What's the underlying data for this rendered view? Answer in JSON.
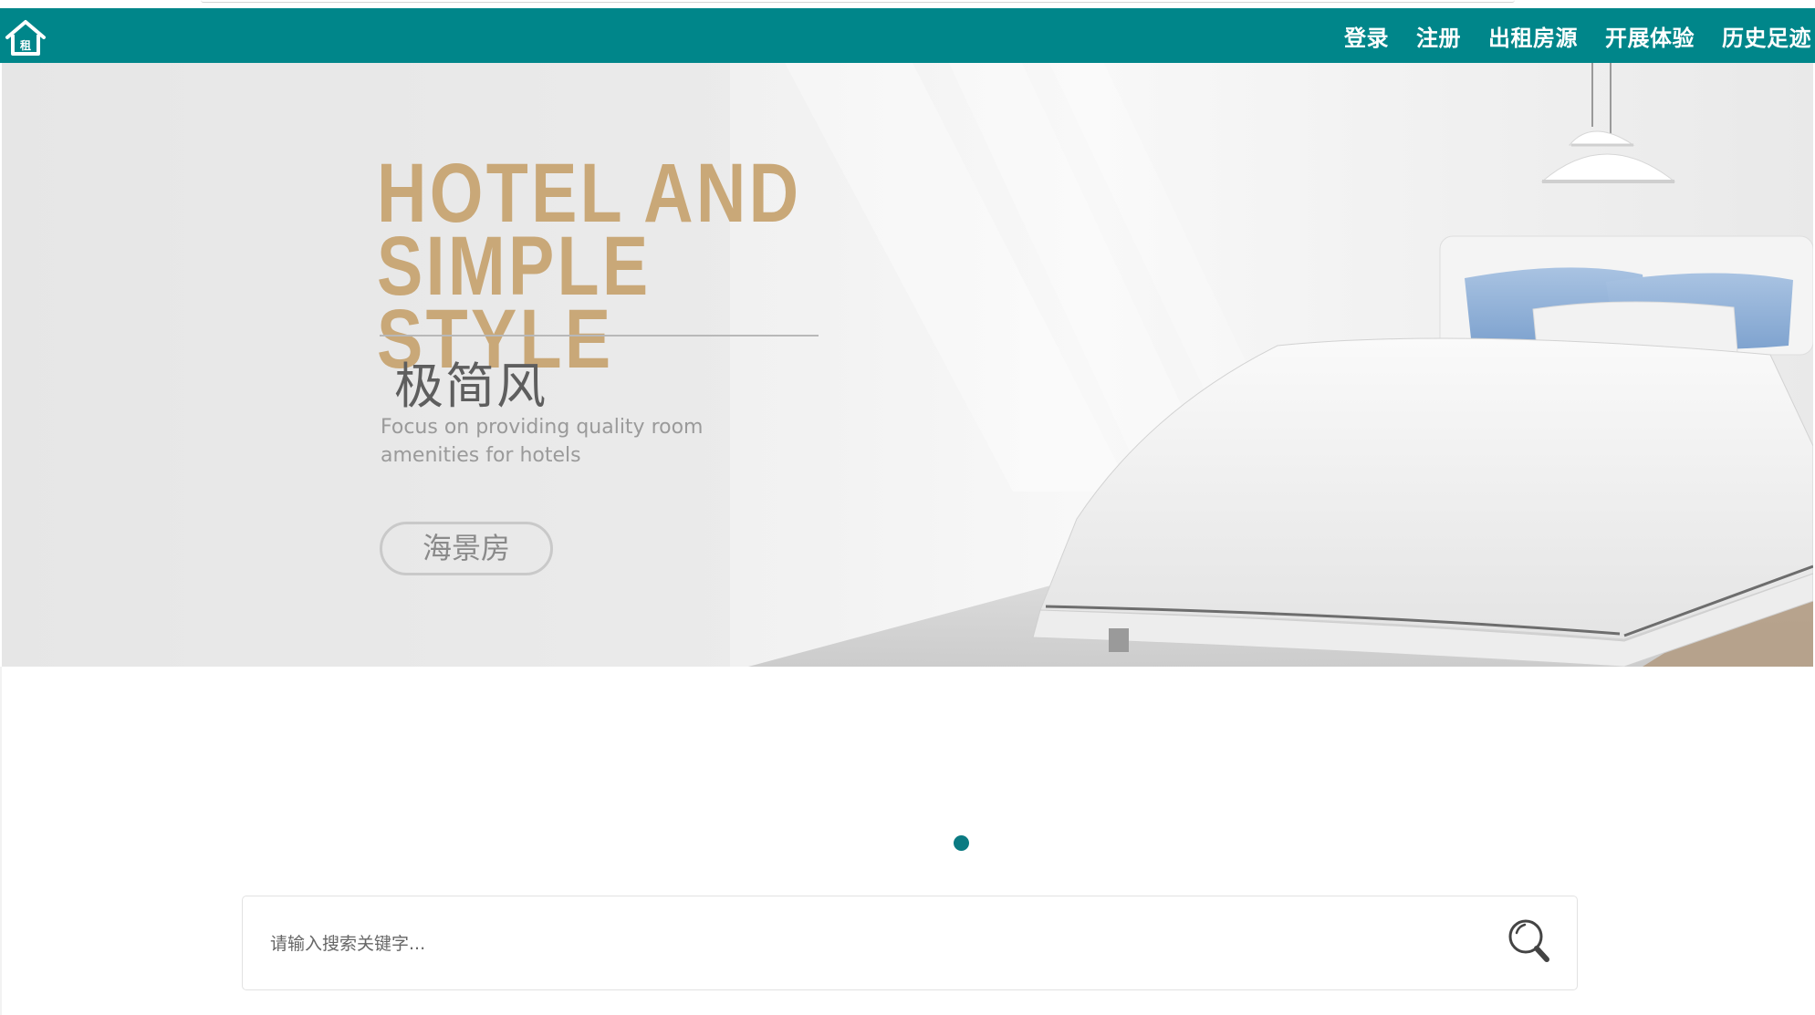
{
  "colors": {
    "nav_background": "#00868a",
    "hero_title": "#c9a878",
    "carousel_active_dot": "#0b7a82"
  },
  "header": {
    "logo_icon": "house-icon",
    "logo_glyph": "租",
    "nav": [
      {
        "label": "登录"
      },
      {
        "label": "注册"
      },
      {
        "label": "出租房源"
      },
      {
        "label": "开展体验"
      },
      {
        "label": "历史足迹"
      }
    ]
  },
  "banner": {
    "title_line1": "HOTEL AND",
    "title_line2": "SIMPLE STYLE",
    "subtitle_cn": "极简风",
    "subtitle_en_line1": "Focus on providing quality room",
    "subtitle_en_line2": "amenities for hotels",
    "button_label": "海景房"
  },
  "carousel": {
    "slide_count": 1,
    "active_index": 0
  },
  "search": {
    "placeholder": "请输入搜索关键字...",
    "value": "",
    "icon": "search-icon"
  }
}
